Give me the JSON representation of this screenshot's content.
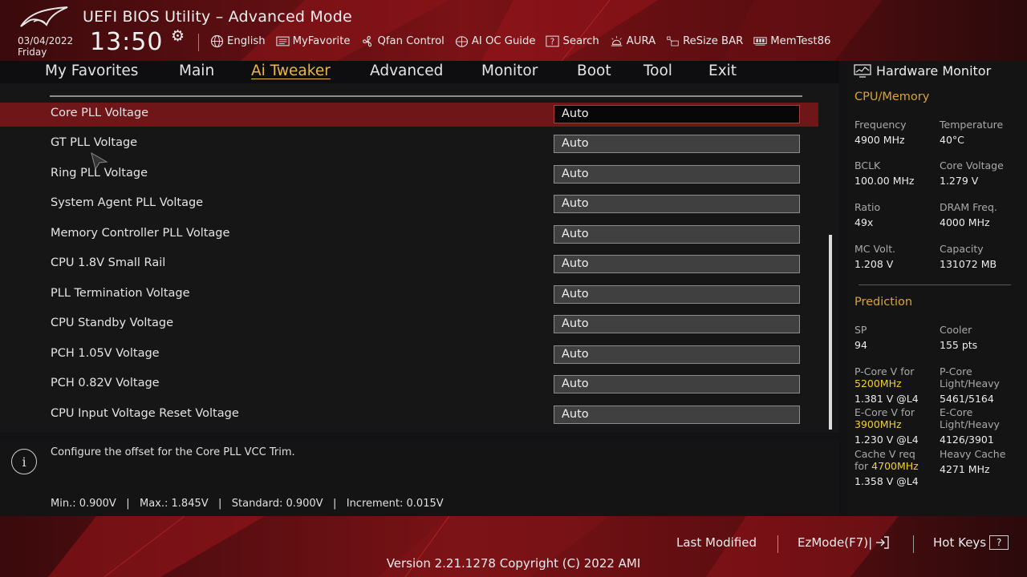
{
  "header": {
    "title": "UEFI BIOS Utility – Advanced Mode",
    "date": "03/04/2022",
    "day": "Friday",
    "time": "13:50",
    "toolbar": [
      {
        "label": "English",
        "icon": "globe-icon"
      },
      {
        "label": "MyFavorite",
        "icon": "favorite-list-icon"
      },
      {
        "label": "Qfan Control",
        "icon": "fan-icon"
      },
      {
        "label": "AI OC Guide",
        "icon": "ai-chip-icon"
      },
      {
        "label": "Search",
        "icon": "search-box-icon"
      },
      {
        "label": "AURA",
        "icon": "aura-light-icon"
      },
      {
        "label": "ReSize BAR",
        "icon": "resize-bar-icon"
      },
      {
        "label": "MemTest86",
        "icon": "memory-icon"
      }
    ]
  },
  "menu": {
    "items": [
      "My Favorites",
      "Main",
      "Ai Tweaker",
      "Advanced",
      "Monitor",
      "Boot",
      "Tool",
      "Exit"
    ],
    "active": "Ai Tweaker"
  },
  "settings": {
    "rows": [
      {
        "label": "Core PLL Voltage",
        "value": "Auto",
        "selected": true
      },
      {
        "label": "GT PLL Voltage",
        "value": "Auto"
      },
      {
        "label": "Ring PLL Voltage",
        "value": "Auto"
      },
      {
        "label": "System Agent PLL Voltage",
        "value": "Auto"
      },
      {
        "label": "Memory Controller PLL Voltage",
        "value": "Auto"
      },
      {
        "label": "CPU 1.8V Small Rail",
        "value": "Auto"
      },
      {
        "label": "PLL Termination Voltage",
        "value": "Auto"
      },
      {
        "label": "CPU Standby Voltage",
        "value": "Auto"
      },
      {
        "label": "PCH 1.05V Voltage",
        "value": "Auto"
      },
      {
        "label": "PCH 0.82V Voltage",
        "value": "Auto"
      },
      {
        "label": "CPU Input Voltage Reset Voltage",
        "value": "Auto"
      }
    ]
  },
  "help": {
    "description": "Configure the offset for the Core PLL VCC Trim.",
    "range": "Min.: 0.900V   |   Max.: 1.845V   |   Standard: 0.900V   |   Increment: 0.015V"
  },
  "hardware_monitor": {
    "title": "Hardware Monitor",
    "cpu_memory": {
      "section": "CPU/Memory",
      "frequency_label": "Frequency",
      "frequency": "4900 MHz",
      "temperature_label": "Temperature",
      "temperature": "40°C",
      "bclk_label": "BCLK",
      "bclk": "100.00 MHz",
      "core_voltage_label": "Core Voltage",
      "core_voltage": "1.279 V",
      "ratio_label": "Ratio",
      "ratio": "49x",
      "dram_freq_label": "DRAM Freq.",
      "dram_freq": "4000 MHz",
      "mc_volt_label": "MC Volt.",
      "mc_volt": "1.208 V",
      "capacity_label": "Capacity",
      "capacity": "131072 MB"
    },
    "prediction": {
      "section": "Prediction",
      "sp_label": "SP",
      "sp": "94",
      "cooler_label": "Cooler",
      "cooler": "155 pts",
      "pcore_v_label": "P-Core V for",
      "pcore_v_freq": "5200MHz",
      "pcore_v": "1.381 V @L4",
      "pcore_label_1": "P-Core",
      "pcore_label_2": "Light/Heavy",
      "pcore_lh": "5461/5164",
      "ecore_v_label": "E-Core V for",
      "ecore_v_freq": "3900MHz",
      "ecore_v": "1.230 V @L4",
      "ecore_label_1": "E-Core",
      "ecore_label_2": "Light/Heavy",
      "ecore_lh": "4126/3901",
      "cache_v_label_1": "Cache V req",
      "cache_v_label_2": "for",
      "cache_v_freq": "4700MHz",
      "cache_v": "1.358 V @L4",
      "heavy_cache_label": "Heavy Cache",
      "heavy_cache": "4271 MHz"
    }
  },
  "footer": {
    "last_modified": "Last Modified",
    "ezmode": "EzMode(F7)|",
    "hot_keys": "Hot Keys",
    "hot_keys_key": "?",
    "version": "Version 2.21.1278 Copyright (C) 2022 AMI"
  },
  "colors": {
    "accent": "#e9b64a",
    "selected_row": "#6f1619",
    "prediction_highlight": "#f2d02b"
  }
}
